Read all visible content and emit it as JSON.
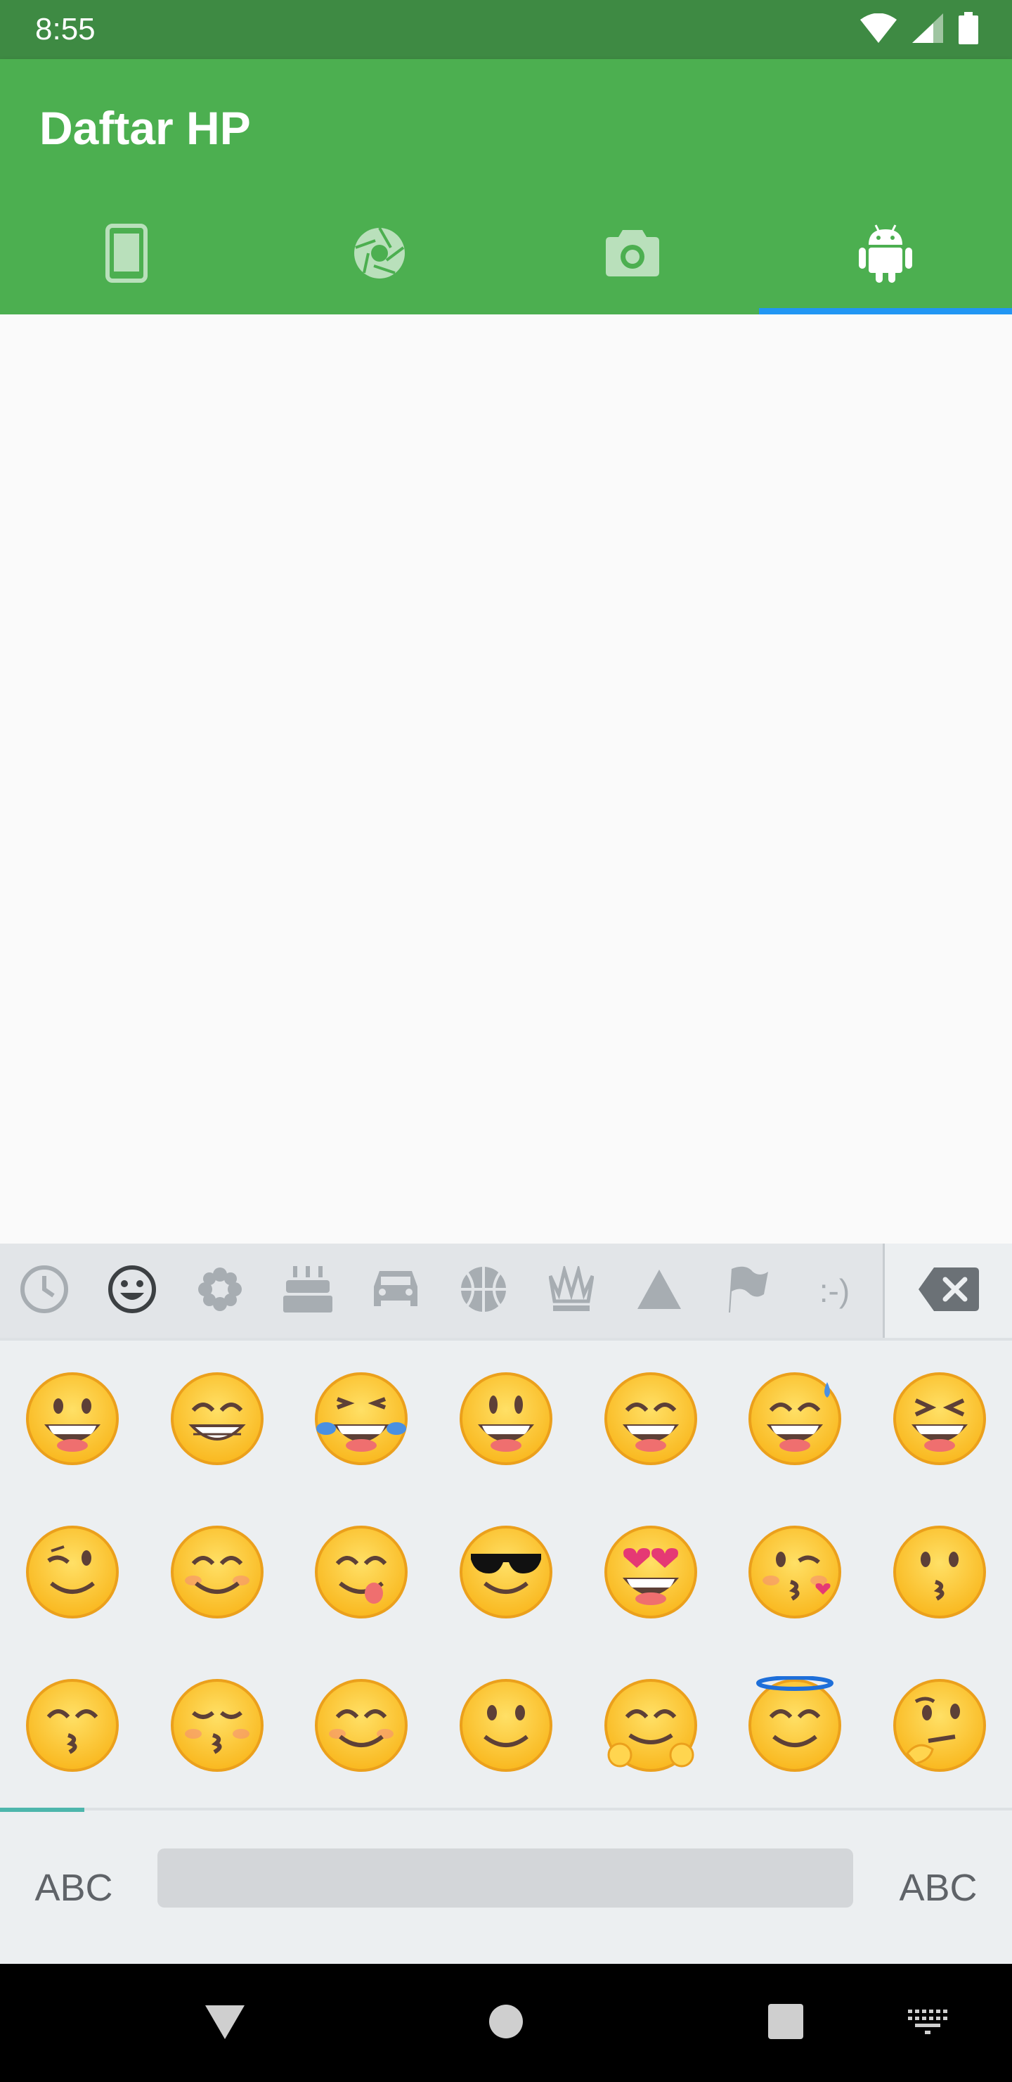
{
  "status_bar": {
    "time": "8:55",
    "icons": [
      "wifi-icon",
      "signal-icon",
      "battery-icon"
    ]
  },
  "app_bar": {
    "title": "Daftar HP",
    "background": "#4caf50",
    "tabs": [
      {
        "icon": "smartphone-icon",
        "selected": false
      },
      {
        "icon": "camera-aperture-icon",
        "selected": false
      },
      {
        "icon": "camera-icon",
        "selected": false
      },
      {
        "icon": "android-icon",
        "selected": true
      }
    ],
    "indicator_color": "#2196f3"
  },
  "keyboard": {
    "categories": [
      {
        "icon": "recent-clock-icon",
        "selected": false
      },
      {
        "icon": "smiley-icon",
        "selected": true
      },
      {
        "icon": "flower-icon",
        "selected": false
      },
      {
        "icon": "cake-icon",
        "selected": false
      },
      {
        "icon": "car-icon",
        "selected": false
      },
      {
        "icon": "basketball-icon",
        "selected": false
      },
      {
        "icon": "crown-icon",
        "selected": false
      },
      {
        "icon": "triangle-icon",
        "selected": false
      },
      {
        "icon": "flag-icon",
        "selected": false
      },
      {
        "label": ":-)",
        "selected": false
      }
    ],
    "delete_icon": "backspace-icon",
    "emojis": [
      "grinning-face",
      "beaming-face",
      "tears-of-joy",
      "smiley",
      "grin-eyes",
      "sweat-smile",
      "squinting-laugh",
      "winking",
      "smiling-blush",
      "yum-tongue",
      "sunglasses",
      "heart-eyes",
      "blowing-kiss",
      "kissing",
      "kissing-smiling-eyes",
      "kissing-closed-eyes",
      "blush",
      "slight-smile",
      "hugging",
      "halo",
      "thinking"
    ],
    "left_label": "ABC",
    "right_label": "ABC"
  },
  "nav_bar": {
    "buttons": [
      "back-icon",
      "home-icon",
      "recents-icon",
      "keyboard-icon"
    ]
  }
}
